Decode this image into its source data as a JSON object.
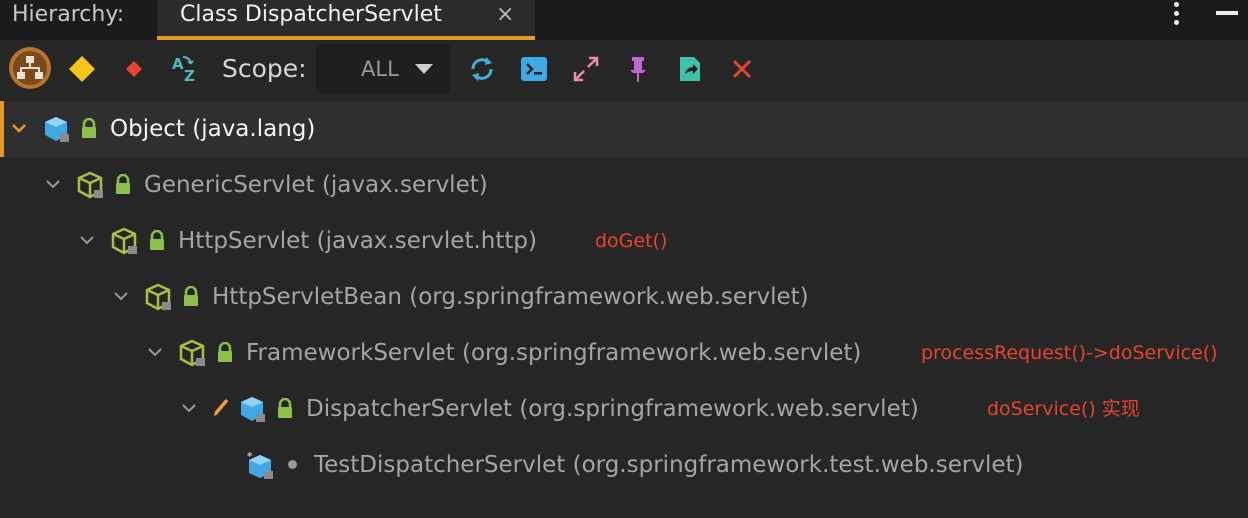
{
  "tabbar": {
    "label": "Hierarchy:",
    "tab_title": "Class DispatcherServlet",
    "tab_close": "×"
  },
  "toolbar": {
    "scope_label": "Scope:",
    "scope_value": "ALL",
    "icons": [
      "class-hierarchy-icon",
      "supertypes-icon",
      "subtypes-icon",
      "sort-alphabetically-icon",
      "refresh-icon",
      "terminal-icon",
      "expand-icon",
      "pin-icon",
      "export-icon",
      "close-icon"
    ]
  },
  "colors": {
    "accent": "#e69a2a",
    "annotation": "#e8432e",
    "class_icon": "#3fa9e4",
    "abstract_icon": "#a8c23f"
  },
  "tree": [
    {
      "name": "Object",
      "pkg": "(java.lang)",
      "note": ""
    },
    {
      "name": "GenericServlet",
      "pkg": "(javax.servlet)",
      "note": ""
    },
    {
      "name": "HttpServlet",
      "pkg": "(javax.servlet.http)",
      "note": "doGet()"
    },
    {
      "name": "HttpServletBean",
      "pkg": "(org.springframework.web.servlet)",
      "note": ""
    },
    {
      "name": "FrameworkServlet",
      "pkg": "(org.springframework.web.servlet)",
      "note": "processRequest()->doService()"
    },
    {
      "name": "DispatcherServlet",
      "pkg": "(org.springframework.web.servlet)",
      "note": "doService() 实现"
    },
    {
      "name": "TestDispatcherServlet",
      "pkg": "(org.springframework.test.web.servlet)",
      "note": ""
    }
  ]
}
